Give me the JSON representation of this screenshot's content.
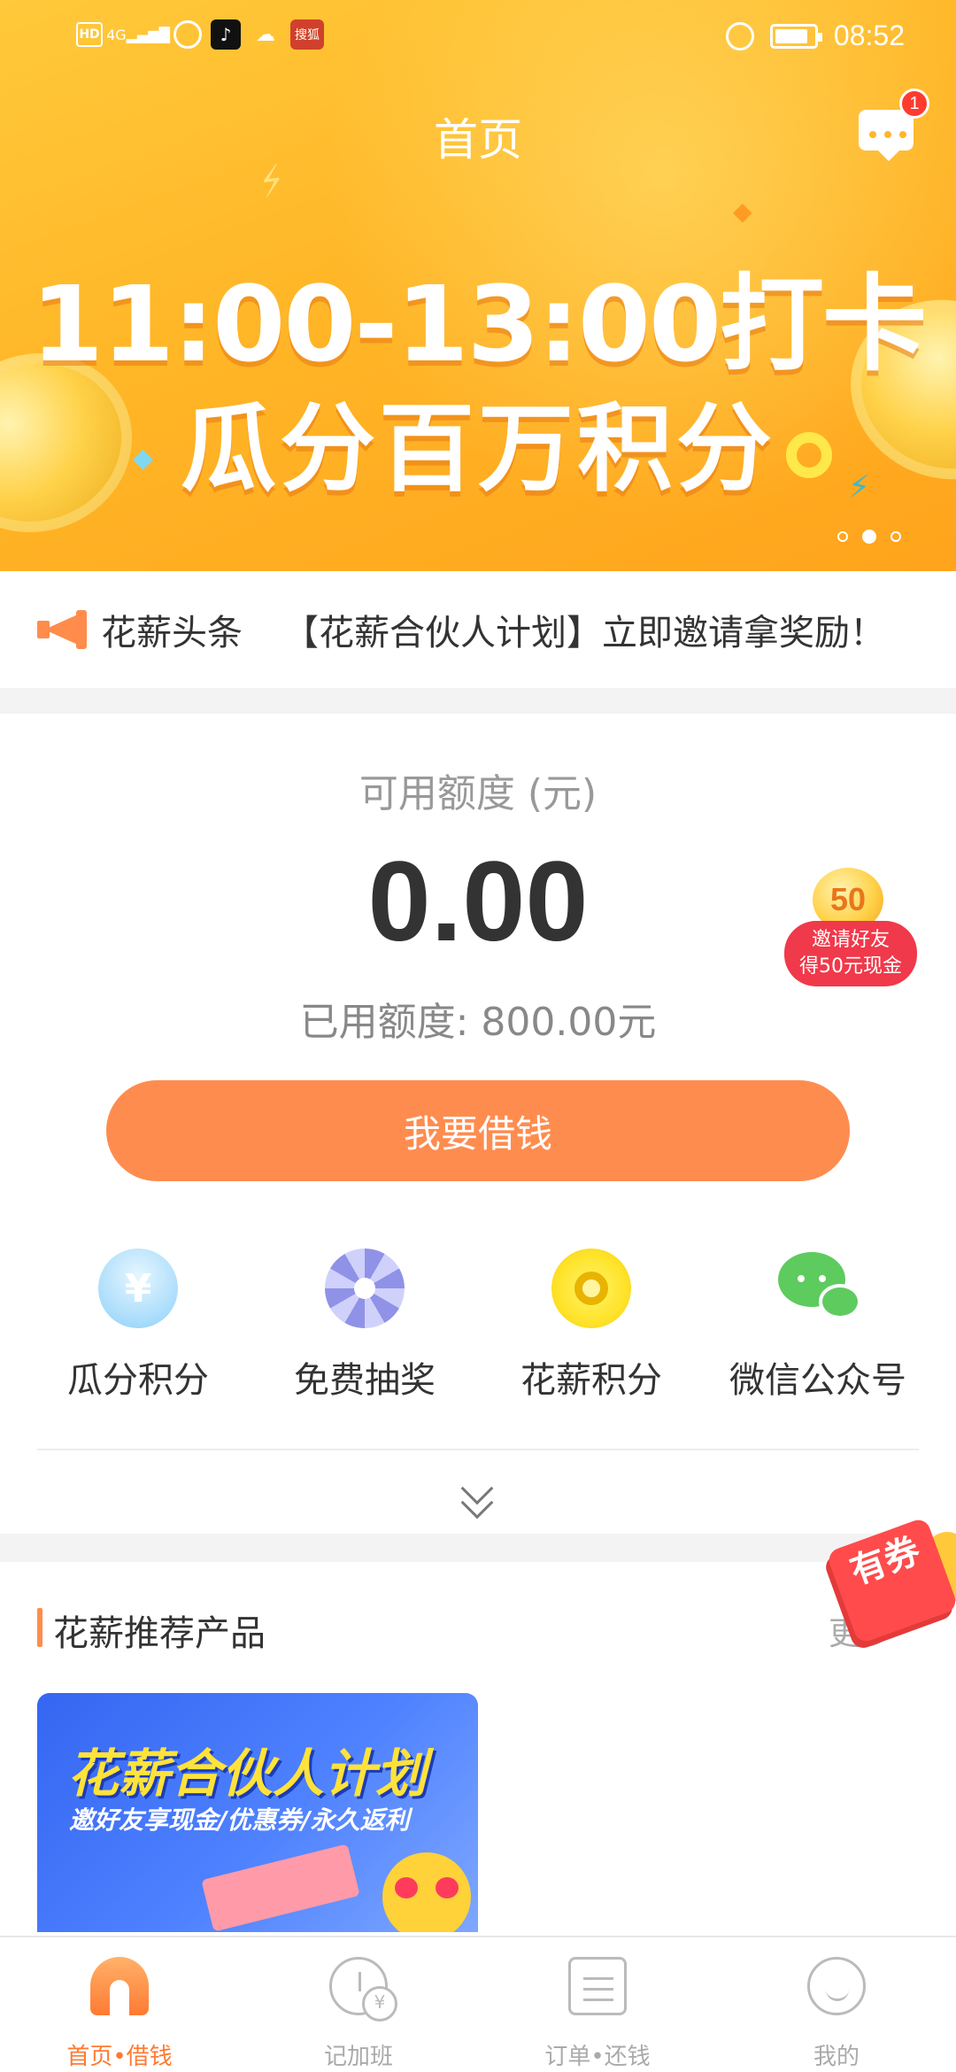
{
  "status_bar": {
    "hd_label": "HD",
    "signal_label": "4G",
    "app_label": "搜狐",
    "time": "08:52"
  },
  "header": {
    "title": "首页",
    "message_badge": "1"
  },
  "banner": {
    "line1": "11:00-13:00打卡",
    "line2": "瓜分百万积分",
    "page_count": 3,
    "active_page": 2
  },
  "headline": {
    "brand": "花薪头条",
    "news": "【花薪合伙人计划】立即邀请拿奖励！"
  },
  "credit": {
    "available_label": "可用额度 (元)",
    "available_amount": "0.00",
    "used_text": "已用额度: 800.00元",
    "borrow_button": "我要借钱"
  },
  "invite": {
    "coin_value": "50",
    "line1": "邀请好友",
    "line2": "得50元现金"
  },
  "quick_actions": [
    {
      "label": "瓜分积分",
      "icon": "yuan-shield-icon"
    },
    {
      "label": "免费抽奖",
      "icon": "wheel-icon"
    },
    {
      "label": "花薪积分",
      "icon": "points-coin-icon"
    },
    {
      "label": "微信公众号",
      "icon": "wechat-icon"
    }
  ],
  "recommended": {
    "title": "花薪推荐产品",
    "more": "更多",
    "coupon": "有券",
    "product": {
      "title": "花薪合伙人计划",
      "subtitle": "邀好友享现金/优惠券/永久返利"
    }
  },
  "bottom_nav": [
    {
      "label": "首页•借钱",
      "active": true
    },
    {
      "label": "记加班",
      "active": false
    },
    {
      "label": "订单•还钱",
      "active": false
    },
    {
      "label": "我的",
      "active": false
    }
  ],
  "colors": {
    "accent": "#ff8c4f",
    "banner": "#ffb627",
    "badge": "#ff3b30"
  }
}
